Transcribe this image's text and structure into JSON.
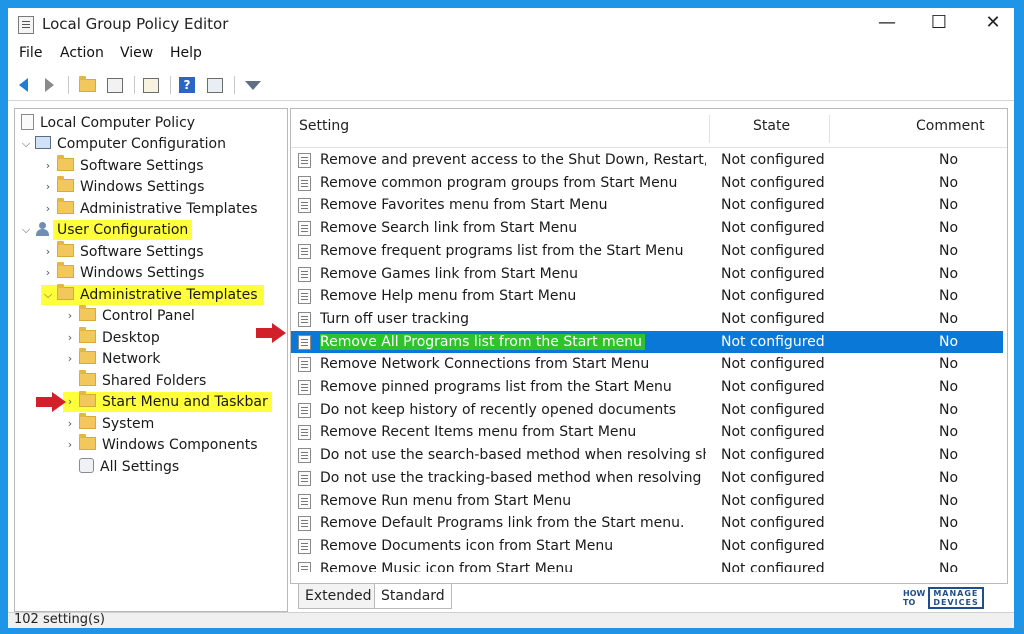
{
  "window": {
    "title": "Local Group Policy Editor",
    "controls": {
      "minimize": "—",
      "maximize": "☐",
      "close": "✕"
    }
  },
  "menubar": [
    "File",
    "Action",
    "View",
    "Help"
  ],
  "toolbar": {
    "icons": [
      "back-arrow-icon",
      "forward-arrow-icon",
      "up-folder-icon",
      "show-hide-tree-icon",
      "export-list-icon",
      "help-icon",
      "properties-icon",
      "filter-icon"
    ],
    "help_glyph": "?"
  },
  "tree": {
    "root": "Local Computer Policy",
    "computer_configuration": "Computer Configuration",
    "computer_children": [
      "Software Settings",
      "Windows Settings",
      "Administrative Templates"
    ],
    "user_configuration": "User Configuration",
    "user_children": [
      "Software Settings",
      "Windows Settings"
    ],
    "administrative_templates": "Administrative Templates",
    "admin_children": [
      "Control Panel",
      "Desktop",
      "Network",
      "Shared Folders",
      "Start Menu and Taskbar",
      "System",
      "Windows Components",
      "All Settings"
    ]
  },
  "list": {
    "headers": {
      "setting": "Setting",
      "state": "State",
      "comment": "Comment"
    },
    "rows": [
      {
        "setting": "Remove and prevent access to the Shut Down, Restart, Sleep...",
        "state": "Not configured",
        "comment": "No"
      },
      {
        "setting": "Remove common program groups from Start Menu",
        "state": "Not configured",
        "comment": "No"
      },
      {
        "setting": "Remove Favorites menu from Start Menu",
        "state": "Not configured",
        "comment": "No"
      },
      {
        "setting": "Remove Search link from Start Menu",
        "state": "Not configured",
        "comment": "No"
      },
      {
        "setting": "Remove frequent programs list from the Start Menu",
        "state": "Not configured",
        "comment": "No"
      },
      {
        "setting": "Remove Games link from Start Menu",
        "state": "Not configured",
        "comment": "No"
      },
      {
        "setting": "Remove Help menu from Start Menu",
        "state": "Not configured",
        "comment": "No"
      },
      {
        "setting": "Turn off user tracking",
        "state": "Not configured",
        "comment": "No"
      },
      {
        "setting": "Remove All Programs list from the Start menu",
        "state": "Not configured",
        "comment": "No"
      },
      {
        "setting": "Remove Network Connections from Start Menu",
        "state": "Not configured",
        "comment": "No"
      },
      {
        "setting": "Remove pinned programs list from the Start Menu",
        "state": "Not configured",
        "comment": "No"
      },
      {
        "setting": "Do not keep history of recently opened documents",
        "state": "Not configured",
        "comment": "No"
      },
      {
        "setting": "Remove Recent Items menu from Start Menu",
        "state": "Not configured",
        "comment": "No"
      },
      {
        "setting": "Do not use the search-based method when resolving shell s...",
        "state": "Not configured",
        "comment": "No"
      },
      {
        "setting": "Do not use the tracking-based method when resolving shell ...",
        "state": "Not configured",
        "comment": "No"
      },
      {
        "setting": "Remove Run menu from Start Menu",
        "state": "Not configured",
        "comment": "No"
      },
      {
        "setting": "Remove Default Programs link from the Start menu.",
        "state": "Not configured",
        "comment": "No"
      },
      {
        "setting": "Remove Documents icon from Start Menu",
        "state": "Not configured",
        "comment": "No"
      },
      {
        "setting": "Remove Music icon from Start Menu",
        "state": "Not configured",
        "comment": "No"
      }
    ]
  },
  "tabs": [
    "Extended",
    "Standard"
  ],
  "status": "102 setting(s)",
  "watermark": {
    "line1": "HOW",
    "line2": "TO",
    "box1": "MANAGE",
    "box2": "DEVICES"
  },
  "colors": {
    "selection": "#0a78d7",
    "highlight_yellow": "#ffff3c",
    "highlight_green": "#2ec32e",
    "annotation_red": "#d2202a",
    "frame_blue": "#1e95e6"
  }
}
